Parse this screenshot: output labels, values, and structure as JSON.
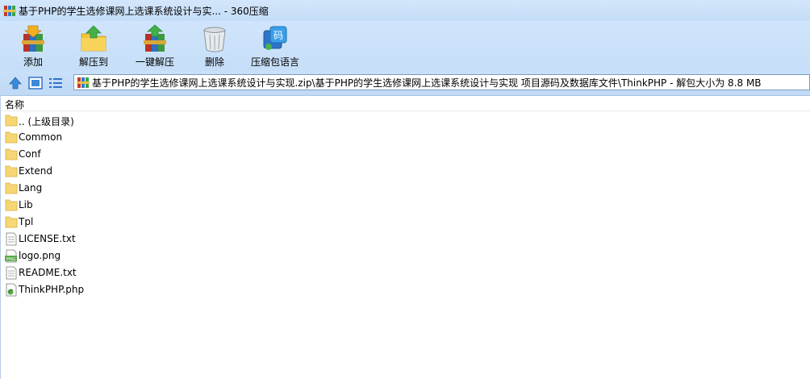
{
  "window": {
    "title": "基于PHP的学生选修课网上选课系统设计与实... - 360压缩"
  },
  "toolbar": {
    "buttons": [
      {
        "label": "添加",
        "icon": "add-archive-icon"
      },
      {
        "label": "解压到",
        "icon": "extract-to-icon"
      },
      {
        "label": "一键解压",
        "icon": "one-click-extract-icon"
      },
      {
        "label": "删除",
        "icon": "delete-trash-icon"
      },
      {
        "label": "压缩包语言",
        "icon": "archive-language-icon"
      }
    ],
    "language_glyph": "码"
  },
  "address": {
    "path": "基于PHP的学生选修课网上选课系统设计与实现.zip\\基于PHP的学生选修课网上选课系统设计与实现 项目源码及数据库文件\\ThinkPHP - 解包大小为 8.8 MB"
  },
  "list": {
    "column_name": "名称",
    "items": [
      {
        "name": ".. (上级目录)",
        "type": "folder"
      },
      {
        "name": "Common",
        "type": "folder"
      },
      {
        "name": "Conf",
        "type": "folder"
      },
      {
        "name": "Extend",
        "type": "folder"
      },
      {
        "name": "Lang",
        "type": "folder"
      },
      {
        "name": "Lib",
        "type": "folder"
      },
      {
        "name": "Tpl",
        "type": "folder"
      },
      {
        "name": "LICENSE.txt",
        "type": "text"
      },
      {
        "name": "logo.png",
        "type": "png"
      },
      {
        "name": "README.txt",
        "type": "text"
      },
      {
        "name": "ThinkPHP.php",
        "type": "php"
      }
    ]
  },
  "colors": {
    "toolbar_bg": "#c9e0f9",
    "folder": "#f7d774",
    "accent": "#3a7fd5"
  }
}
